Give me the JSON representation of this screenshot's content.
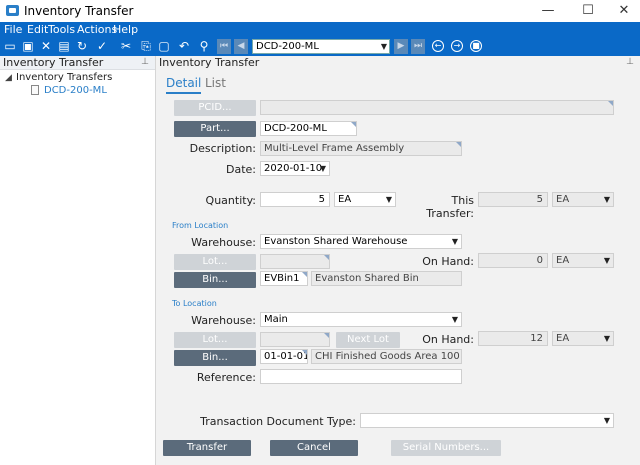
{
  "window": {
    "title": "Inventory Transfer",
    "min": "—",
    "max": "☐",
    "close": "✕"
  },
  "menu": [
    "File",
    "Edit",
    "Tools",
    "Actions",
    "Help"
  ],
  "toolbar": {
    "record": "DCD-200-ML"
  },
  "left": {
    "header": "Inventory Transfer",
    "tree_root": "Inventory Transfers",
    "tree_child": "DCD-200-ML"
  },
  "right": {
    "header": "Inventory Transfer",
    "tabs": [
      "Detail",
      "List"
    ],
    "pcid_label": "PCID...",
    "part_label": "Part...",
    "part_value": "DCD-200-ML",
    "description_label": "Description:",
    "description_value": "Multi-Level Frame Assembly",
    "date_label": "Date:",
    "date_value": "2020-01-10",
    "quantity_label": "Quantity:",
    "quantity_value": "5",
    "quantity_uom": "EA",
    "this_transfer_label": "This Transfer:",
    "this_transfer_value": "5",
    "this_transfer_uom": "EA",
    "from_section": "From Location",
    "from_warehouse_label": "Warehouse:",
    "from_warehouse_value": "Evanston Shared Warehouse",
    "from_lot_label": "Lot...",
    "from_onhand_label": "On Hand:",
    "from_onhand_value": "0",
    "from_onhand_uom": "EA",
    "from_bin_label": "Bin...",
    "from_bin_value": "EVBin1",
    "from_bin_desc": "Evanston Shared Bin",
    "to_section": "To Location",
    "to_warehouse_label": "Warehouse:",
    "to_warehouse_value": "Main",
    "to_lot_label": "Lot...",
    "next_lot_label": "Next Lot",
    "to_onhand_label": "On Hand:",
    "to_onhand_value": "12",
    "to_onhand_uom": "EA",
    "to_bin_label": "Bin...",
    "to_bin_value": "01-01-01",
    "to_bin_desc": "CHI Finished Goods Area 100",
    "reference_label": "Reference:",
    "reference_value": "",
    "tdt_label": "Transaction Document Type:",
    "tdt_value": "",
    "transfer_button": "Transfer",
    "cancel_button": "Cancel",
    "serial_button": "Serial Numbers..."
  }
}
